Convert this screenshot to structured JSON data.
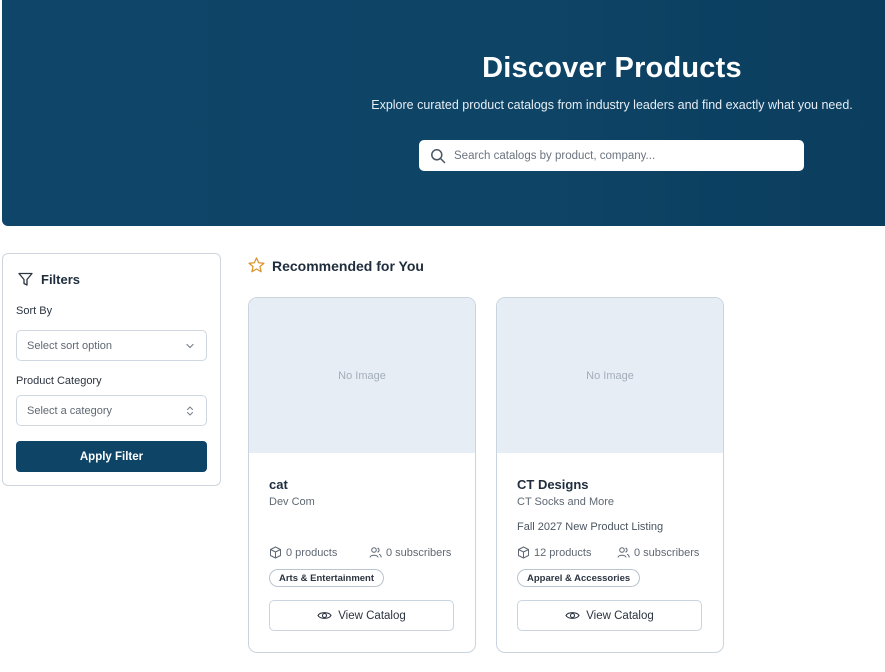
{
  "hero": {
    "title": "Discover Products",
    "subtitle": "Explore curated product catalogs from industry leaders and find exactly what you need.",
    "search_placeholder": "Search catalogs by product, company..."
  },
  "filters": {
    "title": "Filters",
    "sort_label": "Sort By",
    "sort_placeholder": "Select sort option",
    "category_label": "Product Category",
    "category_placeholder": "Select a category",
    "apply_label": "Apply Filter"
  },
  "recommended": {
    "title": "Recommended for You",
    "cards": [
      {
        "image_text": "No Image",
        "title": "cat",
        "company": "Dev Com",
        "description": "",
        "products": "0 products",
        "subscribers": "0 subscribers",
        "category": "Arts & Entertainment",
        "button": "View Catalog"
      },
      {
        "image_text": "No Image",
        "title": "CT Designs",
        "company": "CT Socks and More",
        "description": "Fall 2027 New Product Listing",
        "products": "12 products",
        "subscribers": "0 subscribers",
        "category": "Apparel & Accessories",
        "button": "View Catalog"
      }
    ]
  },
  "colors": {
    "hero_bg": "#0e4466",
    "primary_button": "#0e4466",
    "star_accent": "#d9932b",
    "image_placeholder_bg": "#e7edf5"
  }
}
